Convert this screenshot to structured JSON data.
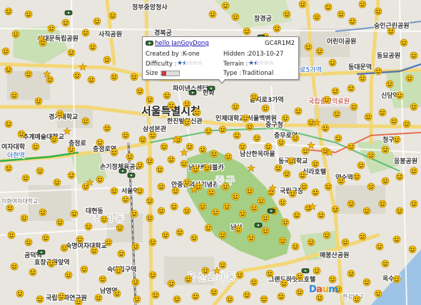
{
  "popup": {
    "cache_name": "hello JanGoyDong",
    "cache_code": "GC4R1M2",
    "created_by_label": "Created by :",
    "created_by": "K-one",
    "hidden_label": "Hidden :",
    "hidden_date": "2013-10-27",
    "difficulty_label": "Difficulty :",
    "difficulty_stars": 1.5,
    "terrain_label": "Terrain :",
    "terrain_stars": 1.5,
    "size_label": "Size :",
    "size_value": 0.25,
    "type_label": "Type :",
    "type_value": "Traditional"
  },
  "logo": {
    "text": "Daum",
    "colors": [
      "#2f86d9",
      "#e8522f",
      "#f5b000",
      "#2f86d9"
    ]
  },
  "map_labels": [
    {
      "text": "정부중앙청사",
      "kind": "b"
    },
    {
      "text": "사직공원",
      "kind": "b"
    },
    {
      "text": "경복궁",
      "kind": "b"
    },
    {
      "text": "창경궁",
      "kind": "b"
    },
    {
      "text": "서대문독립공원",
      "kind": "b"
    },
    {
      "text": "어린이공원",
      "kind": "b"
    },
    {
      "text": "숭인근린공원",
      "kind": "b"
    },
    {
      "text": "동묘공원",
      "kind": "b"
    },
    {
      "text": "동대문역",
      "kind": "b"
    },
    {
      "text": "종로5가역",
      "kind": "blue"
    },
    {
      "text": "파이낸스센터",
      "kind": "b"
    },
    {
      "text": "한화",
      "kind": "b"
    },
    {
      "text": "을지로3가역",
      "kind": "b"
    },
    {
      "text": "국립중앙의료원",
      "kind": "red"
    },
    {
      "text": "신당역",
      "kind": "b"
    },
    {
      "text": "서울특별시청",
      "kind": "big"
    },
    {
      "text": "인제대학교 서울백병원",
      "kind": "b"
    },
    {
      "text": "중구청",
      "kind": "b"
    },
    {
      "text": "충무로역",
      "kind": "b"
    },
    {
      "text": "경기대학교",
      "kind": "b"
    },
    {
      "text": "한진빌딩신관",
      "kind": "b"
    },
    {
      "text": "삼성본관",
      "kind": "b"
    },
    {
      "text": "추계예술대학교",
      "kind": "b"
    },
    {
      "text": "충정로역",
      "kind": "b"
    },
    {
      "text": "남산한옥마을",
      "kind": "b"
    },
    {
      "text": "동국대학교",
      "kind": "b"
    },
    {
      "text": "청구역",
      "kind": "b"
    },
    {
      "text": "손기정체육공원",
      "kind": "b"
    },
    {
      "text": "남산케이블카",
      "kind": "b"
    },
    {
      "text": "신라호텔",
      "kind": "b"
    },
    {
      "text": "약수역",
      "kind": "b"
    },
    {
      "text": "서울역",
      "kind": "b"
    },
    {
      "text": "안중근의사기념관",
      "kind": "b"
    },
    {
      "text": "중구",
      "kind": "district"
    },
    {
      "text": "국립극장",
      "kind": "b"
    },
    {
      "text": "응봉공원",
      "kind": "b"
    },
    {
      "text": "이화여자대학교",
      "kind": "gray"
    },
    {
      "text": "청파동",
      "kind": "district"
    },
    {
      "text": "남산",
      "kind": "b"
    },
    {
      "text": "숙명여자대학교",
      "kind": "b"
    },
    {
      "text": "공덕역",
      "kind": "b"
    },
    {
      "text": "용산2가동",
      "kind": "district"
    },
    {
      "text": "매봉산공원",
      "kind": "b"
    },
    {
      "text": "그랜드하얏트호텔",
      "kind": "b"
    },
    {
      "text": "국립전파연구원",
      "kind": "b"
    },
    {
      "text": "옥수역",
      "kind": "b"
    },
    {
      "text": "숙대입구역",
      "kind": "b"
    },
    {
      "text": "효창공원앞역",
      "kind": "b"
    },
    {
      "text": "남영역",
      "kind": "b"
    },
    {
      "text": "아현역",
      "kind": "blue"
    },
    {
      "text": "한강대교",
      "kind": "gray"
    },
    {
      "text": "여자대학",
      "kind": "b"
    },
    {
      "text": "대현동",
      "kind": "b"
    },
    {
      "text": "충정로",
      "kind": "b"
    }
  ]
}
